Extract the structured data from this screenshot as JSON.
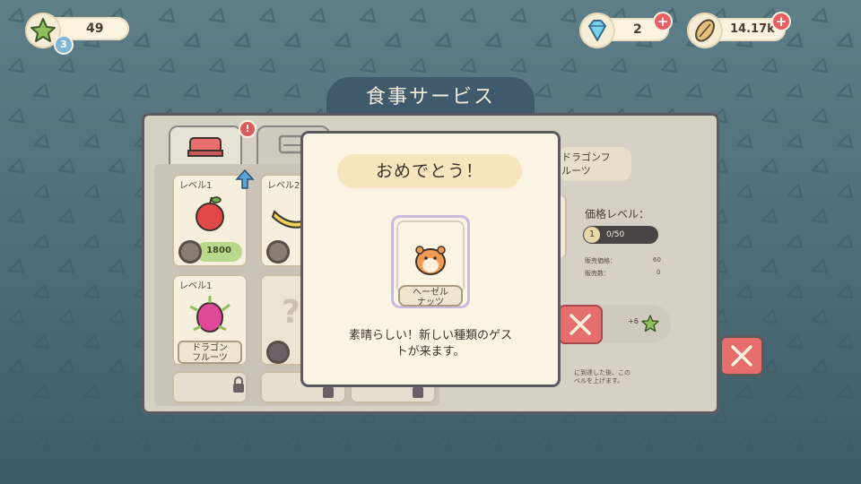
{
  "hud": {
    "stars": "49",
    "player_level": "3",
    "gems": "2",
    "seeds": "14.17k"
  },
  "panel": {
    "title": "食事サービス"
  },
  "cards": [
    {
      "level": "レベル1",
      "item": "apple",
      "price": "1800"
    },
    {
      "level": "レベル2",
      "item": "banana",
      "price": ""
    },
    {
      "level": "レベル1",
      "item": "dragon-fruit",
      "name": "ドラゴン\nフルーツ"
    }
  ],
  "detail": {
    "name": "ドラゴンフ\nルーツ",
    "price_level_label": "価格レベル：",
    "price_level": "1",
    "price_progress": "0/50",
    "sell_price_label": "販売価格：",
    "sell_price": "60",
    "sold_label": "販売数：",
    "sold": "0",
    "reward": "+6",
    "note": "に到達した後、この\nベルを上げます。"
  },
  "dialog": {
    "title": "おめでとう！",
    "guest_name": "ヘーゼル\nナッツ",
    "message": "素晴らしい！新しい種類のゲス\nトが来ます。"
  },
  "colors": {
    "accent_red": "#e86d6d",
    "title_bar": "#3e5a6c",
    "price_green": "#b9d98a"
  }
}
